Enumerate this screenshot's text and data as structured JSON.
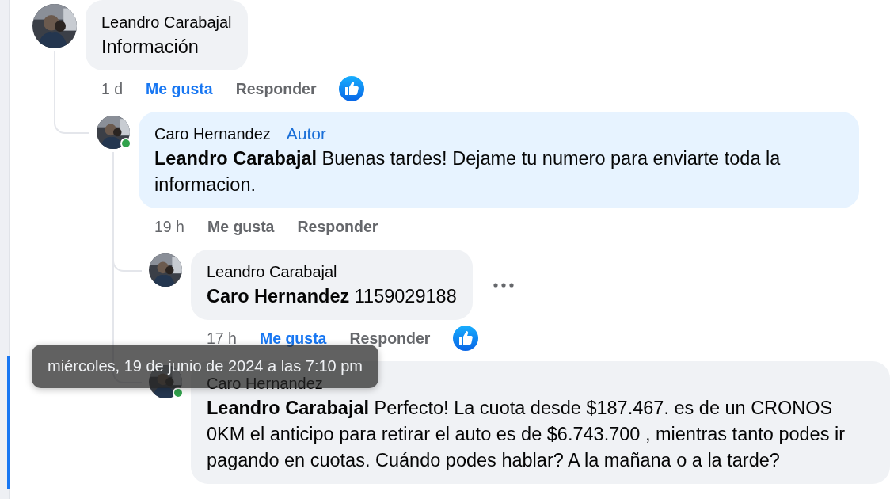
{
  "comments": [
    {
      "author": "Leandro Carabajal",
      "text": "Información",
      "online": false,
      "focused": false,
      "more_menu": false,
      "time": "1 d",
      "like_label": "Me gusta",
      "liked": true,
      "reply_label": "Responder",
      "has_like_reaction": true,
      "children": [
        {
          "author": "Caro Hernandez",
          "badge": "Autor",
          "text": "**Leandro Carabajal** Buenas tardes! Dejame tu numero para enviarte toda la informacion.",
          "online": true,
          "focused": false,
          "more_menu": false,
          "time": "19 h",
          "like_label": "Me gusta",
          "liked": false,
          "reply_label": "Responder",
          "has_like_reaction": false,
          "children": [
            {
              "author": "Leandro Carabajal",
              "text": "**Caro Hernandez** 1159029188",
              "online": false,
              "focused": false,
              "more_menu": true,
              "time": "17 h",
              "like_label": "Me gusta",
              "liked": true,
              "reply_label": "Responder",
              "has_like_reaction": true
            },
            {
              "author": "Caro Hernandez",
              "text": "**Leandro Carabajal** Perfecto! La cuota desde $187.467. es de un CRONOS 0KM el anticipo para retirar el auto es de $6.743.700 , mientras tanto podes ir pagando en cuotas. Cuándo podes hablar? A la mañana o a la tarde?",
              "online": true,
              "focused": true,
              "more_menu": false
            }
          ]
        }
      ]
    }
  ],
  "tooltip": {
    "text": "miércoles, 19 de junio de 2024 a las 7:10 pm"
  }
}
